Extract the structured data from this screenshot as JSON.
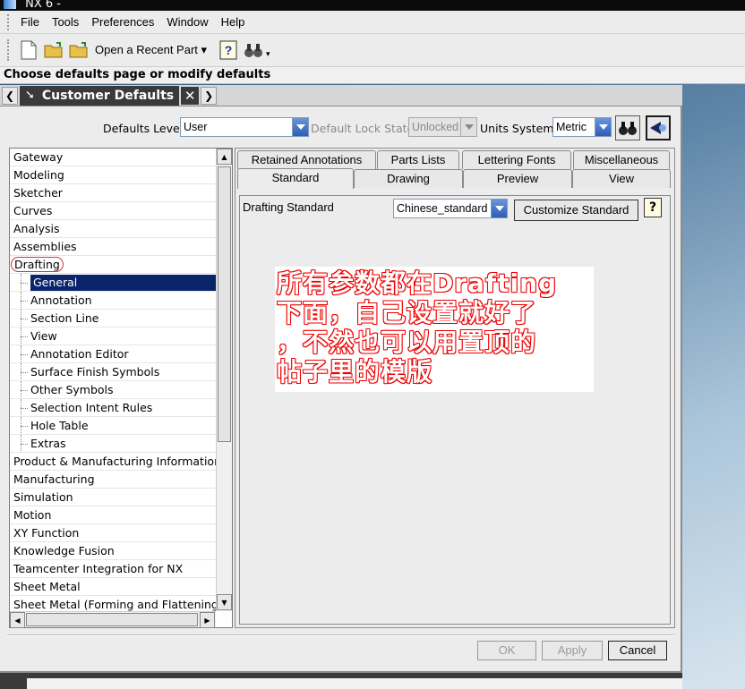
{
  "window": {
    "title": "NX 6 -"
  },
  "menubar": {
    "items": [
      {
        "label": "File"
      },
      {
        "label": "Tools"
      },
      {
        "label": "Preferences"
      },
      {
        "label": "Window"
      },
      {
        "label": "Help"
      }
    ]
  },
  "toolbar": {
    "recent_label": "Open a Recent Part"
  },
  "prompt": "Choose defaults page or modify defaults",
  "doc_tab": {
    "title": "Customer Defaults",
    "close": "✕"
  },
  "defaults_row": {
    "level_label": "Defaults Level",
    "level_value": "User",
    "lock_label": "Default Lock State",
    "lock_value": "Unlocked",
    "units_label": "Units System",
    "units_value": "Metric"
  },
  "tree": {
    "items": [
      {
        "label": "Gateway"
      },
      {
        "label": "Modeling"
      },
      {
        "label": "Sketcher"
      },
      {
        "label": "Curves"
      },
      {
        "label": "Analysis"
      },
      {
        "label": "Assemblies"
      },
      {
        "label": "Drafting"
      },
      {
        "label": "General"
      },
      {
        "label": "Annotation"
      },
      {
        "label": "Section Line"
      },
      {
        "label": "View"
      },
      {
        "label": "Annotation Editor"
      },
      {
        "label": "Surface Finish Symbols"
      },
      {
        "label": "Other Symbols"
      },
      {
        "label": "Selection Intent Rules"
      },
      {
        "label": "Hole Table"
      },
      {
        "label": "Extras"
      },
      {
        "label": "Product & Manufacturing Information"
      },
      {
        "label": "Manufacturing"
      },
      {
        "label": "Simulation"
      },
      {
        "label": "Motion"
      },
      {
        "label": "XY Function"
      },
      {
        "label": "Knowledge Fusion"
      },
      {
        "label": "Teamcenter Integration for NX"
      },
      {
        "label": "Sheet Metal"
      },
      {
        "label": "Sheet Metal (Forming and Flattening)"
      }
    ]
  },
  "tabs": {
    "row1": [
      "Retained Annotations",
      "Parts Lists",
      "Lettering Fonts",
      "Miscellaneous"
    ],
    "row2": [
      "Standard",
      "Drawing",
      "Preview",
      "View"
    ]
  },
  "standard": {
    "label": "Drafting Standard",
    "value": "Chinese_standard",
    "customize": "Customize Standard",
    "help": "?"
  },
  "annotation": {
    "lines": [
      "所有参数都在Drafting",
      "下面，自己设置就好了",
      "，不然也可以用置顶的",
      "帖子里的模版"
    ]
  },
  "footer": {
    "ok": "OK",
    "apply": "Apply",
    "cancel": "Cancel"
  }
}
